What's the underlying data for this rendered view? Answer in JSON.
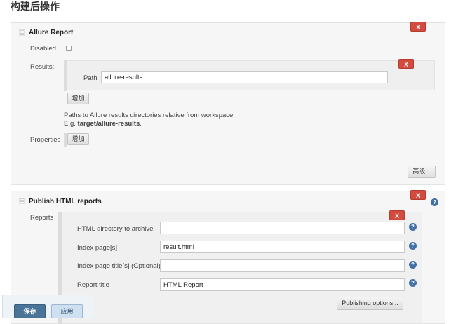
{
  "page": {
    "section_title": "构建后操作"
  },
  "allure": {
    "title": "Allure Report",
    "delete_label": "X",
    "disabled_label": "Disabled",
    "results_label": "Results:",
    "path_label": "Path",
    "path_value": "allure-results",
    "path_delete_label": "X",
    "add_label": "增加",
    "hint_line1": "Paths to Allure results directories relative from workspace.",
    "hint_eg": "E.g.",
    "hint_example": "target/allure-results",
    "hint_end": ".",
    "properties_label": "Properties",
    "properties_add_label": "增加",
    "advanced_label": "高级..."
  },
  "html_reports": {
    "title": "Publish HTML reports",
    "delete_label": "X",
    "reports_label": "Reports",
    "report_delete_label": "X",
    "fields": [
      {
        "label": "HTML directory to archive",
        "value": ""
      },
      {
        "label": "Index page[s]",
        "value": "result.html"
      },
      {
        "label": "Index page title[s] (Optional)",
        "value": ""
      },
      {
        "label": "Report title",
        "value": "HTML Report"
      }
    ],
    "publishing_options_label": "Publishing options..."
  },
  "footer": {
    "save_label": "保存",
    "apply_label": "应用"
  },
  "icons": {
    "help": "?"
  },
  "colors": {
    "delete_red": "#d24b3e",
    "help_blue": "#3f6fa4",
    "save_blue": "#4a7398",
    "apply_light_blue": "#cfe0f0"
  }
}
